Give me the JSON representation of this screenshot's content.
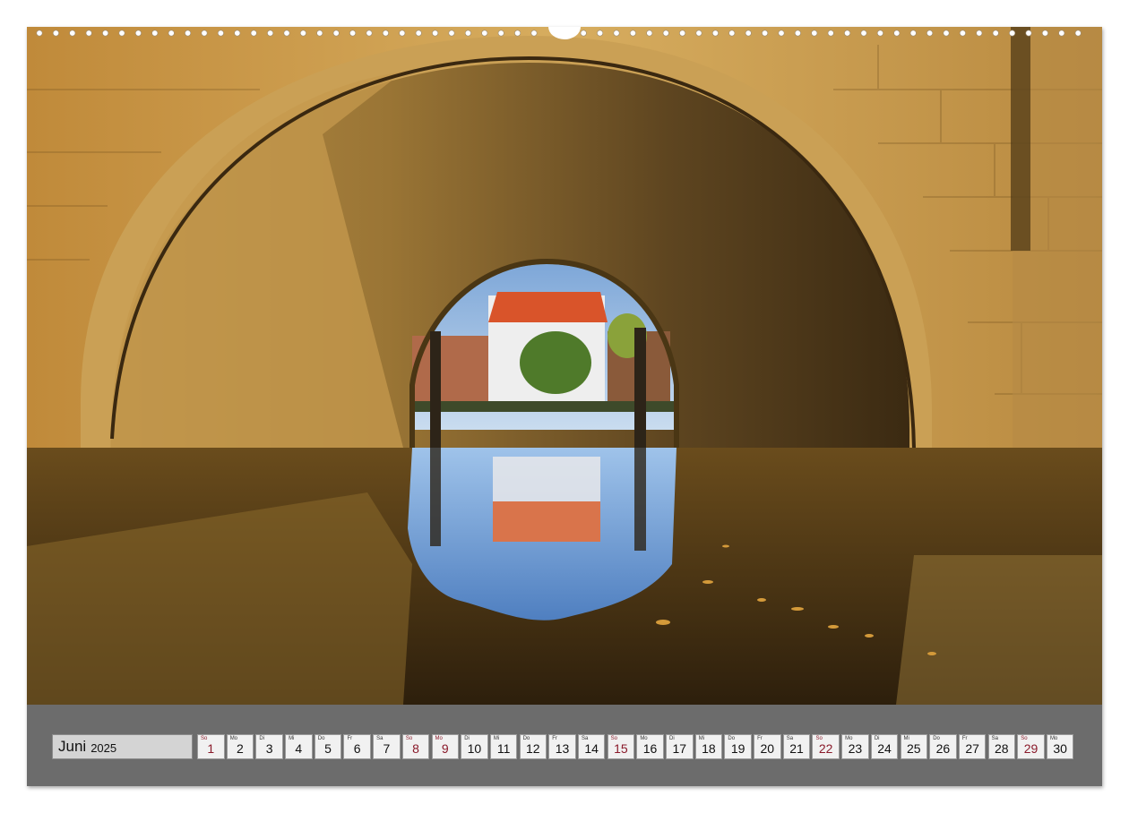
{
  "calendar": {
    "month": "Juni",
    "year": "2025",
    "days": [
      {
        "wd": "So",
        "num": "1",
        "sunday": true
      },
      {
        "wd": "Mo",
        "num": "2",
        "sunday": false
      },
      {
        "wd": "Di",
        "num": "3",
        "sunday": false
      },
      {
        "wd": "Mi",
        "num": "4",
        "sunday": false
      },
      {
        "wd": "Do",
        "num": "5",
        "sunday": false
      },
      {
        "wd": "Fr",
        "num": "6",
        "sunday": false
      },
      {
        "wd": "Sa",
        "num": "7",
        "sunday": false
      },
      {
        "wd": "So",
        "num": "8",
        "sunday": true
      },
      {
        "wd": "Mo",
        "num": "9",
        "sunday": true
      },
      {
        "wd": "Di",
        "num": "10",
        "sunday": false
      },
      {
        "wd": "Mi",
        "num": "11",
        "sunday": false
      },
      {
        "wd": "Do",
        "num": "12",
        "sunday": false
      },
      {
        "wd": "Fr",
        "num": "13",
        "sunday": false
      },
      {
        "wd": "Sa",
        "num": "14",
        "sunday": false
      },
      {
        "wd": "So",
        "num": "15",
        "sunday": true
      },
      {
        "wd": "Mo",
        "num": "16",
        "sunday": false
      },
      {
        "wd": "Di",
        "num": "17",
        "sunday": false
      },
      {
        "wd": "Mi",
        "num": "18",
        "sunday": false
      },
      {
        "wd": "Do",
        "num": "19",
        "sunday": false
      },
      {
        "wd": "Fr",
        "num": "20",
        "sunday": false
      },
      {
        "wd": "Sa",
        "num": "21",
        "sunday": false
      },
      {
        "wd": "So",
        "num": "22",
        "sunday": true
      },
      {
        "wd": "Mo",
        "num": "23",
        "sunday": false
      },
      {
        "wd": "Di",
        "num": "24",
        "sunday": false
      },
      {
        "wd": "Mi",
        "num": "25",
        "sunday": false
      },
      {
        "wd": "Do",
        "num": "26",
        "sunday": false
      },
      {
        "wd": "Fr",
        "num": "27",
        "sunday": false
      },
      {
        "wd": "Sa",
        "num": "28",
        "sunday": false
      },
      {
        "wd": "So",
        "num": "29",
        "sunday": true
      },
      {
        "wd": "Mo",
        "num": "30",
        "sunday": false
      }
    ]
  },
  "colors": {
    "sunday": "#8a1a2a",
    "bar": "#6c6c6c",
    "cell": "#f1f1f1"
  },
  "icons": {
    "binding": "spiral-binding-holes"
  }
}
